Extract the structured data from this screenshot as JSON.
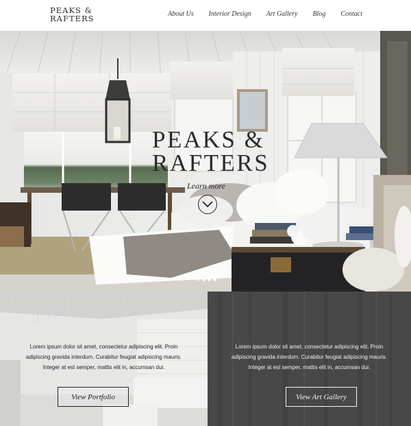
{
  "header": {
    "logo_line1": "PEAKS &",
    "logo_line2": "RAFTERS",
    "nav": [
      "About Us",
      "Interior Design",
      "Art Gallery",
      "Blog",
      "Contact"
    ]
  },
  "hero": {
    "title_line1": "PEAKS &",
    "title_line2": "RAFTERS",
    "subtitle": "Learn more",
    "slide_count": 4,
    "active_slide": 1
  },
  "panels": [
    {
      "text_lines": [
        "Lorem ipsum dolor sit amet, consectetur adipiscing elit. Proin",
        "adipiscing gravida interdum. Curabitur feugiat adipiscing mauris.",
        "Integer at est semper, mattis elit in, accumsan dui."
      ],
      "button": "View Portfolio"
    },
    {
      "text_lines": [
        "Lorem ipsum dolor sit amet, consectetur adipiscing elit. Proin",
        "adipiscing gravida interdum. Curabitur feugiat adipiscing mauris.",
        "Integer at est semper, mattis elit in, accumsan dui."
      ],
      "button": "View Art Gallery"
    }
  ],
  "colors": {
    "header_bg": "#ffffff",
    "text_dark": "#2b2b2b",
    "panel_left_bg": "#e9e9e9",
    "panel_right_bg": "#4a4a4a"
  },
  "icons": [
    "chevron-down-icon"
  ]
}
